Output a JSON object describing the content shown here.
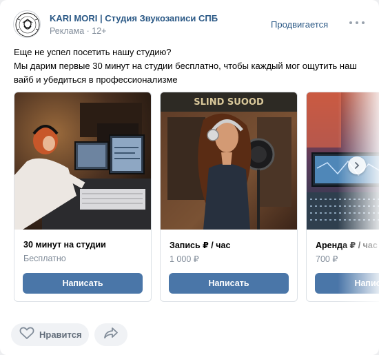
{
  "header": {
    "author": "KARI MORI | Студия Звукозаписи СПБ",
    "meta": "Реклама · 12+",
    "promote_label": "Продвигается"
  },
  "post": {
    "lines": [
      "Еще не успел посетить нашу студию?",
      "Мы дарим первые 30 минут на студии бесплатно, чтобы каждый мог ощутить наш",
      "вайб и убедиться в профессионализме"
    ]
  },
  "cards": [
    {
      "title": "30 минут на студии",
      "price": "Бесплатно",
      "button": "Написать"
    },
    {
      "title": "Запись ₽ / час",
      "price": "1 000 ₽",
      "button": "Написать",
      "image_text": "SLIND SUOOD"
    },
    {
      "title": "Аренда ₽ / час",
      "price": "700 ₽",
      "button": "Написать"
    }
  ],
  "footer": {
    "like_label": "Нравится"
  },
  "icons": {
    "more": "more-icon",
    "like": "heart-icon",
    "share": "share-icon",
    "next": "chevron-right-icon"
  },
  "colors": {
    "link": "#2a5885",
    "button": "#4a76a8",
    "muted": "#818c99"
  }
}
